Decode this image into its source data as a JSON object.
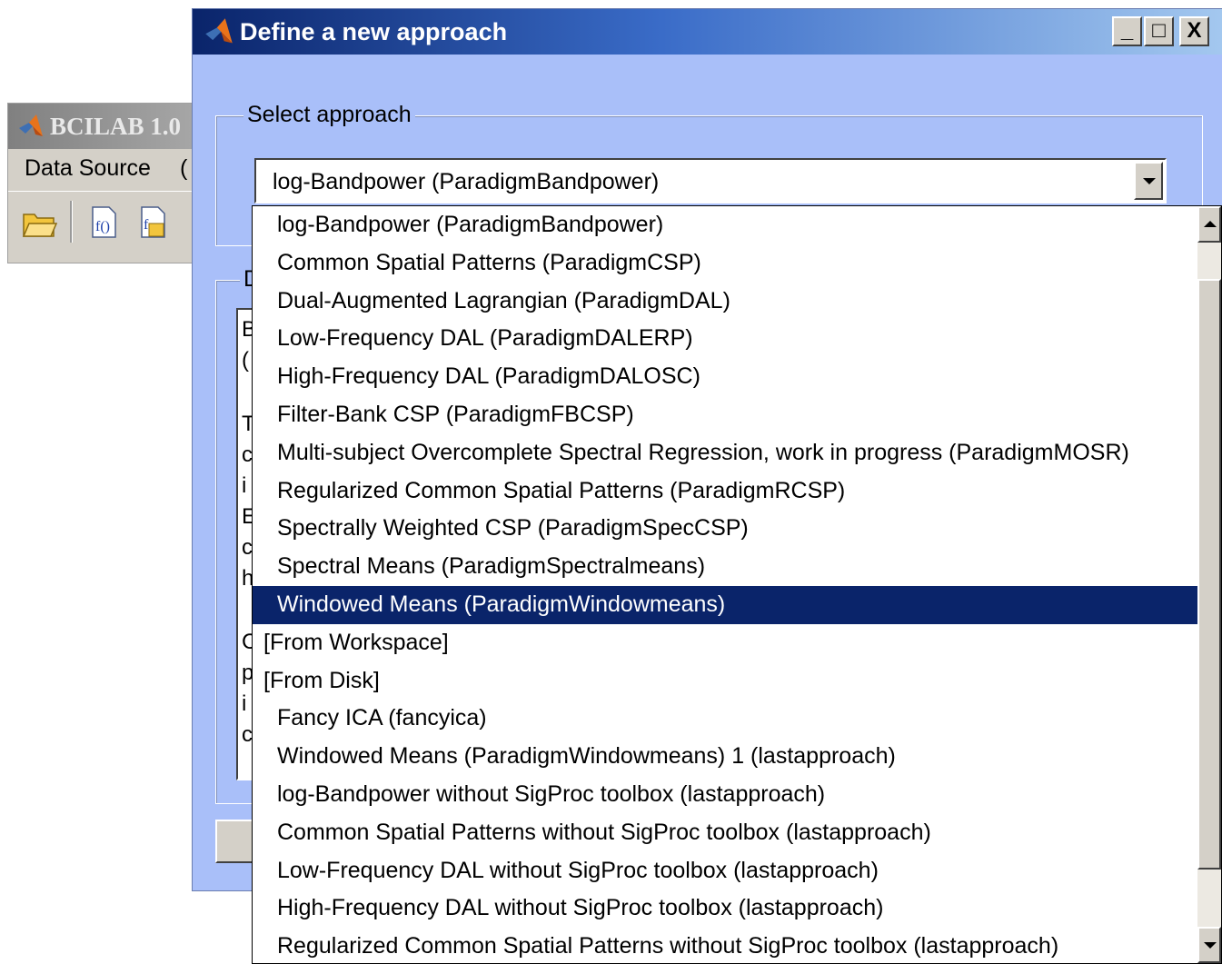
{
  "background_window": {
    "title": "BCILAB 1.0",
    "menu": [
      "Data Source",
      "("
    ]
  },
  "dialog": {
    "title": "Define a new approach",
    "window_buttons": {
      "minimize": "_",
      "maximize": "□",
      "close": "X"
    },
    "select_group_label": "Select approach",
    "selected_value": "log-Bandpower (ParadigmBandpower)",
    "description_group_label": "D",
    "description_line_starts": [
      "B",
      "(",
      "",
      "T",
      "c",
      "i",
      "E",
      "c",
      "h",
      "",
      "C",
      "p",
      "i",
      "c"
    ]
  },
  "dropdown": {
    "items": [
      {
        "label": "log-Bandpower (ParadigmBandpower)",
        "kind": "item"
      },
      {
        "label": "Common Spatial Patterns (ParadigmCSP)",
        "kind": "item"
      },
      {
        "label": "Dual-Augmented Lagrangian (ParadigmDAL)",
        "kind": "item"
      },
      {
        "label": "Low-Frequency DAL (ParadigmDALERP)",
        "kind": "item"
      },
      {
        "label": "High-Frequency DAL (ParadigmDALOSC)",
        "kind": "item"
      },
      {
        "label": "Filter-Bank CSP (ParadigmFBCSP)",
        "kind": "item"
      },
      {
        "label": "Multi-subject Overcomplete Spectral Regression, work in progress (ParadigmMOSR)",
        "kind": "item"
      },
      {
        "label": "Regularized Common Spatial Patterns (ParadigmRCSP)",
        "kind": "item"
      },
      {
        "label": "Spectrally Weighted CSP (ParadigmSpecCSP)",
        "kind": "item"
      },
      {
        "label": "Spectral Means (ParadigmSpectralmeans)",
        "kind": "item"
      },
      {
        "label": "Windowed Means (ParadigmWindowmeans)",
        "kind": "item",
        "selected": true
      },
      {
        "label": "[From Workspace]",
        "kind": "head"
      },
      {
        "label": "[From Disk]",
        "kind": "head"
      },
      {
        "label": "Fancy ICA (fancyica)",
        "kind": "item"
      },
      {
        "label": "Windowed Means (ParadigmWindowmeans) 1 (lastapproach)",
        "kind": "item"
      },
      {
        "label": "log-Bandpower without SigProc toolbox (lastapproach)",
        "kind": "item"
      },
      {
        "label": "Common Spatial Patterns without SigProc toolbox (lastapproach)",
        "kind": "item"
      },
      {
        "label": "Low-Frequency DAL without SigProc toolbox (lastapproach)",
        "kind": "item"
      },
      {
        "label": "High-Frequency DAL without SigProc toolbox (lastapproach)",
        "kind": "item"
      },
      {
        "label": "Regularized Common Spatial Patterns without SigProc toolbox (lastapproach)",
        "kind": "item"
      }
    ]
  },
  "colors": {
    "dialog_bg": "#a9bff9",
    "selection": "#0a246a",
    "title_gradient_start": "#0a246a"
  }
}
